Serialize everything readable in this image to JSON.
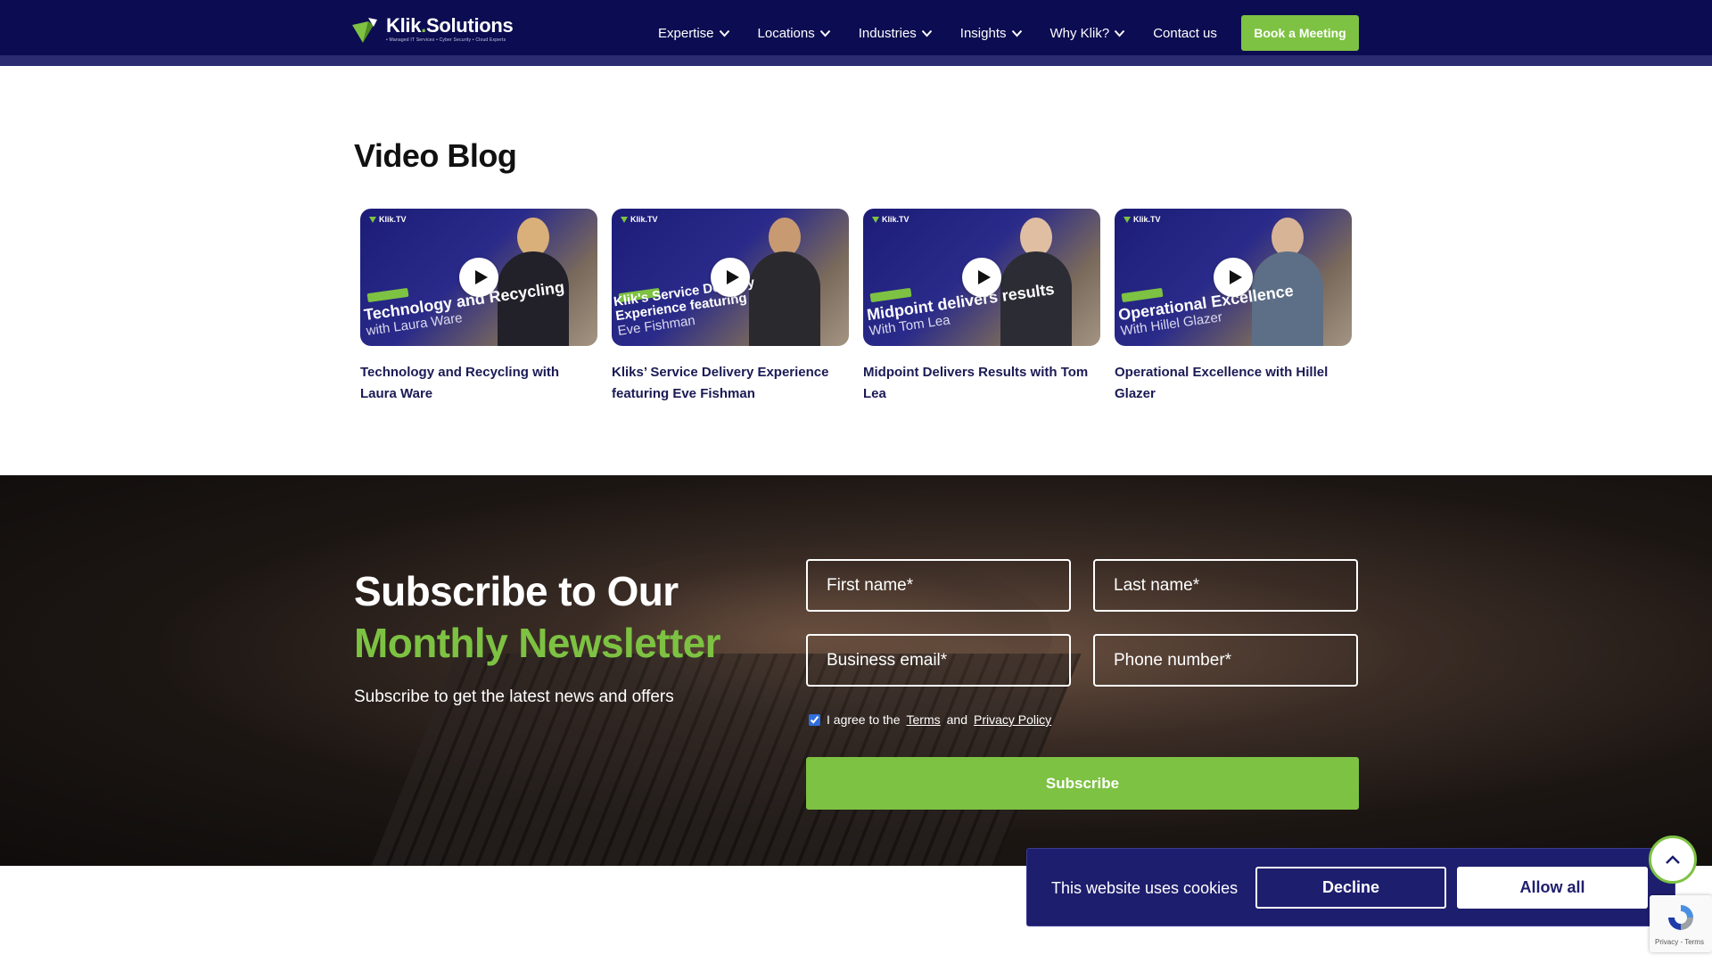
{
  "brand": {
    "name_part1": "Klik",
    "name_sep": ".",
    "name_part2": "Solutions",
    "tagline": "• Managed IT Services • Cyber Security • Cloud Experts",
    "accent_color": "#7dc242",
    "navy_color": "#0c0c52"
  },
  "nav": {
    "items": [
      {
        "label": "Expertise"
      },
      {
        "label": "Locations"
      },
      {
        "label": "Industries"
      },
      {
        "label": "Insights"
      },
      {
        "label": "Why Klik?"
      },
      {
        "label": "Contact us"
      }
    ],
    "cta_label": "Book a Meeting"
  },
  "video_blog": {
    "title": "Video Blog",
    "videos": [
      {
        "caption": "Technology and Recycling with Laura Ware",
        "thumb_title": "Technology and Recycling",
        "thumb_sub": "with Laura Ware",
        "badge": "Klik.TV"
      },
      {
        "caption": "Kliks’ Service Delivery Experience featuring Eve Fishman",
        "thumb_title": "Klik's Service Delivery Experience featuring",
        "thumb_sub": "Eve Fishman",
        "badge": "Klik.TV"
      },
      {
        "caption": "Midpoint Delivers Results with Tom Lea",
        "thumb_title": "Midpoint delivers results",
        "thumb_sub": "With Tom Lea",
        "badge": "Klik.TV"
      },
      {
        "caption": "Operational Excellence with Hillel Glazer",
        "thumb_title": "Operational Excellence",
        "thumb_sub": "With Hillel Glazer",
        "badge": "Klik.TV"
      }
    ]
  },
  "newsletter": {
    "heading_line1": "Subscribe to Our",
    "heading_line2": "Monthly Newsletter",
    "subtext": "Subscribe to get the latest news and offers",
    "fields": {
      "first_name": "First name*",
      "last_name": "Last name*",
      "email": "Business email*",
      "phone": "Phone number*"
    },
    "agree_prefix": "I agree to the",
    "terms_link": "Terms",
    "agree_and": "and",
    "privacy_link": "Privacy Policy",
    "agree_checked": true,
    "submit_label": "Subscribe"
  },
  "cookie": {
    "text": "This website uses cookies",
    "decline_label": "Decline",
    "allow_label": "Allow all"
  },
  "recaptcha": {
    "footer": "Privacy - Terms"
  }
}
